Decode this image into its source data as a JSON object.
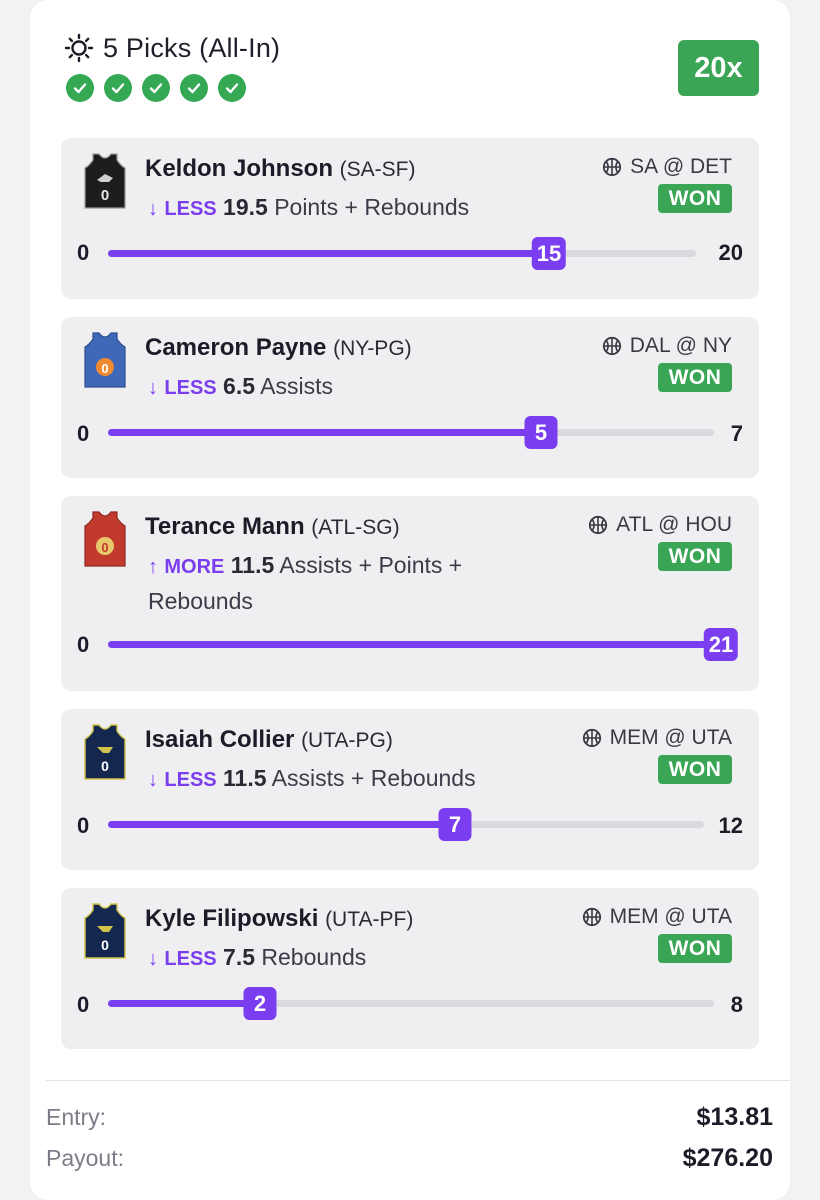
{
  "header": {
    "title": "5 Picks (All-In)",
    "checks": [
      true,
      true,
      true,
      true,
      true
    ],
    "multiplier": "20x"
  },
  "picks": [
    {
      "player": "Keldon Johnson",
      "team_pos": "(SA-SF)",
      "matchup": "SA @ DET",
      "result": "WON",
      "arrow": "↓",
      "direction": "LESS",
      "line": "19.5",
      "stat": "Points + Rebounds",
      "min": "0",
      "max": "20",
      "actual": "15",
      "jersey_color": "#1d1d1d",
      "jersey_trim": "#cfcfcf"
    },
    {
      "player": "Cameron Payne",
      "team_pos": "(NY-PG)",
      "matchup": "DAL @ NY",
      "result": "WON",
      "arrow": "↓",
      "direction": "LESS",
      "line": "6.5",
      "stat": "Assists",
      "min": "0",
      "max": "7",
      "actual": "5",
      "jersey_color": "#3f69b8",
      "jersey_trim": "#f08a30"
    },
    {
      "player": "Terance Mann",
      "team_pos": "(ATL-SG)",
      "matchup": "ATL @ HOU",
      "result": "WON",
      "arrow": "↑",
      "direction": "MORE",
      "line": "11.5",
      "stat": "Assists + Points + Rebounds",
      "min": "0",
      "max": "",
      "actual": "21",
      "jersey_color": "#c23a2e",
      "jersey_trim": "#e8c86a"
    },
    {
      "player": "Isaiah Collier",
      "team_pos": "(UTA-PG)",
      "matchup": "MEM @ UTA",
      "result": "WON",
      "arrow": "↓",
      "direction": "LESS",
      "line": "11.5",
      "stat": "Assists + Rebounds",
      "min": "0",
      "max": "12",
      "actual": "7",
      "jersey_color": "#14284f",
      "jersey_trim": "#d2c44a"
    },
    {
      "player": "Kyle Filipowski",
      "team_pos": "(UTA-PF)",
      "matchup": "MEM @ UTA",
      "result": "WON",
      "arrow": "↓",
      "direction": "LESS",
      "line": "7.5",
      "stat": "Rebounds",
      "min": "0",
      "max": "8",
      "actual": "2",
      "jersey_color": "#14284f",
      "jersey_trim": "#d2c44a"
    }
  ],
  "progress_fractions": [
    0.75,
    0.714,
    1.0,
    0.583,
    0.25
  ],
  "summary": {
    "entry_label": "Entry:",
    "entry_value": "$13.81",
    "payout_label": "Payout:",
    "payout_value": "$276.20"
  },
  "colors": {
    "accent": "#7a3ef0",
    "won": "#3aa655"
  }
}
